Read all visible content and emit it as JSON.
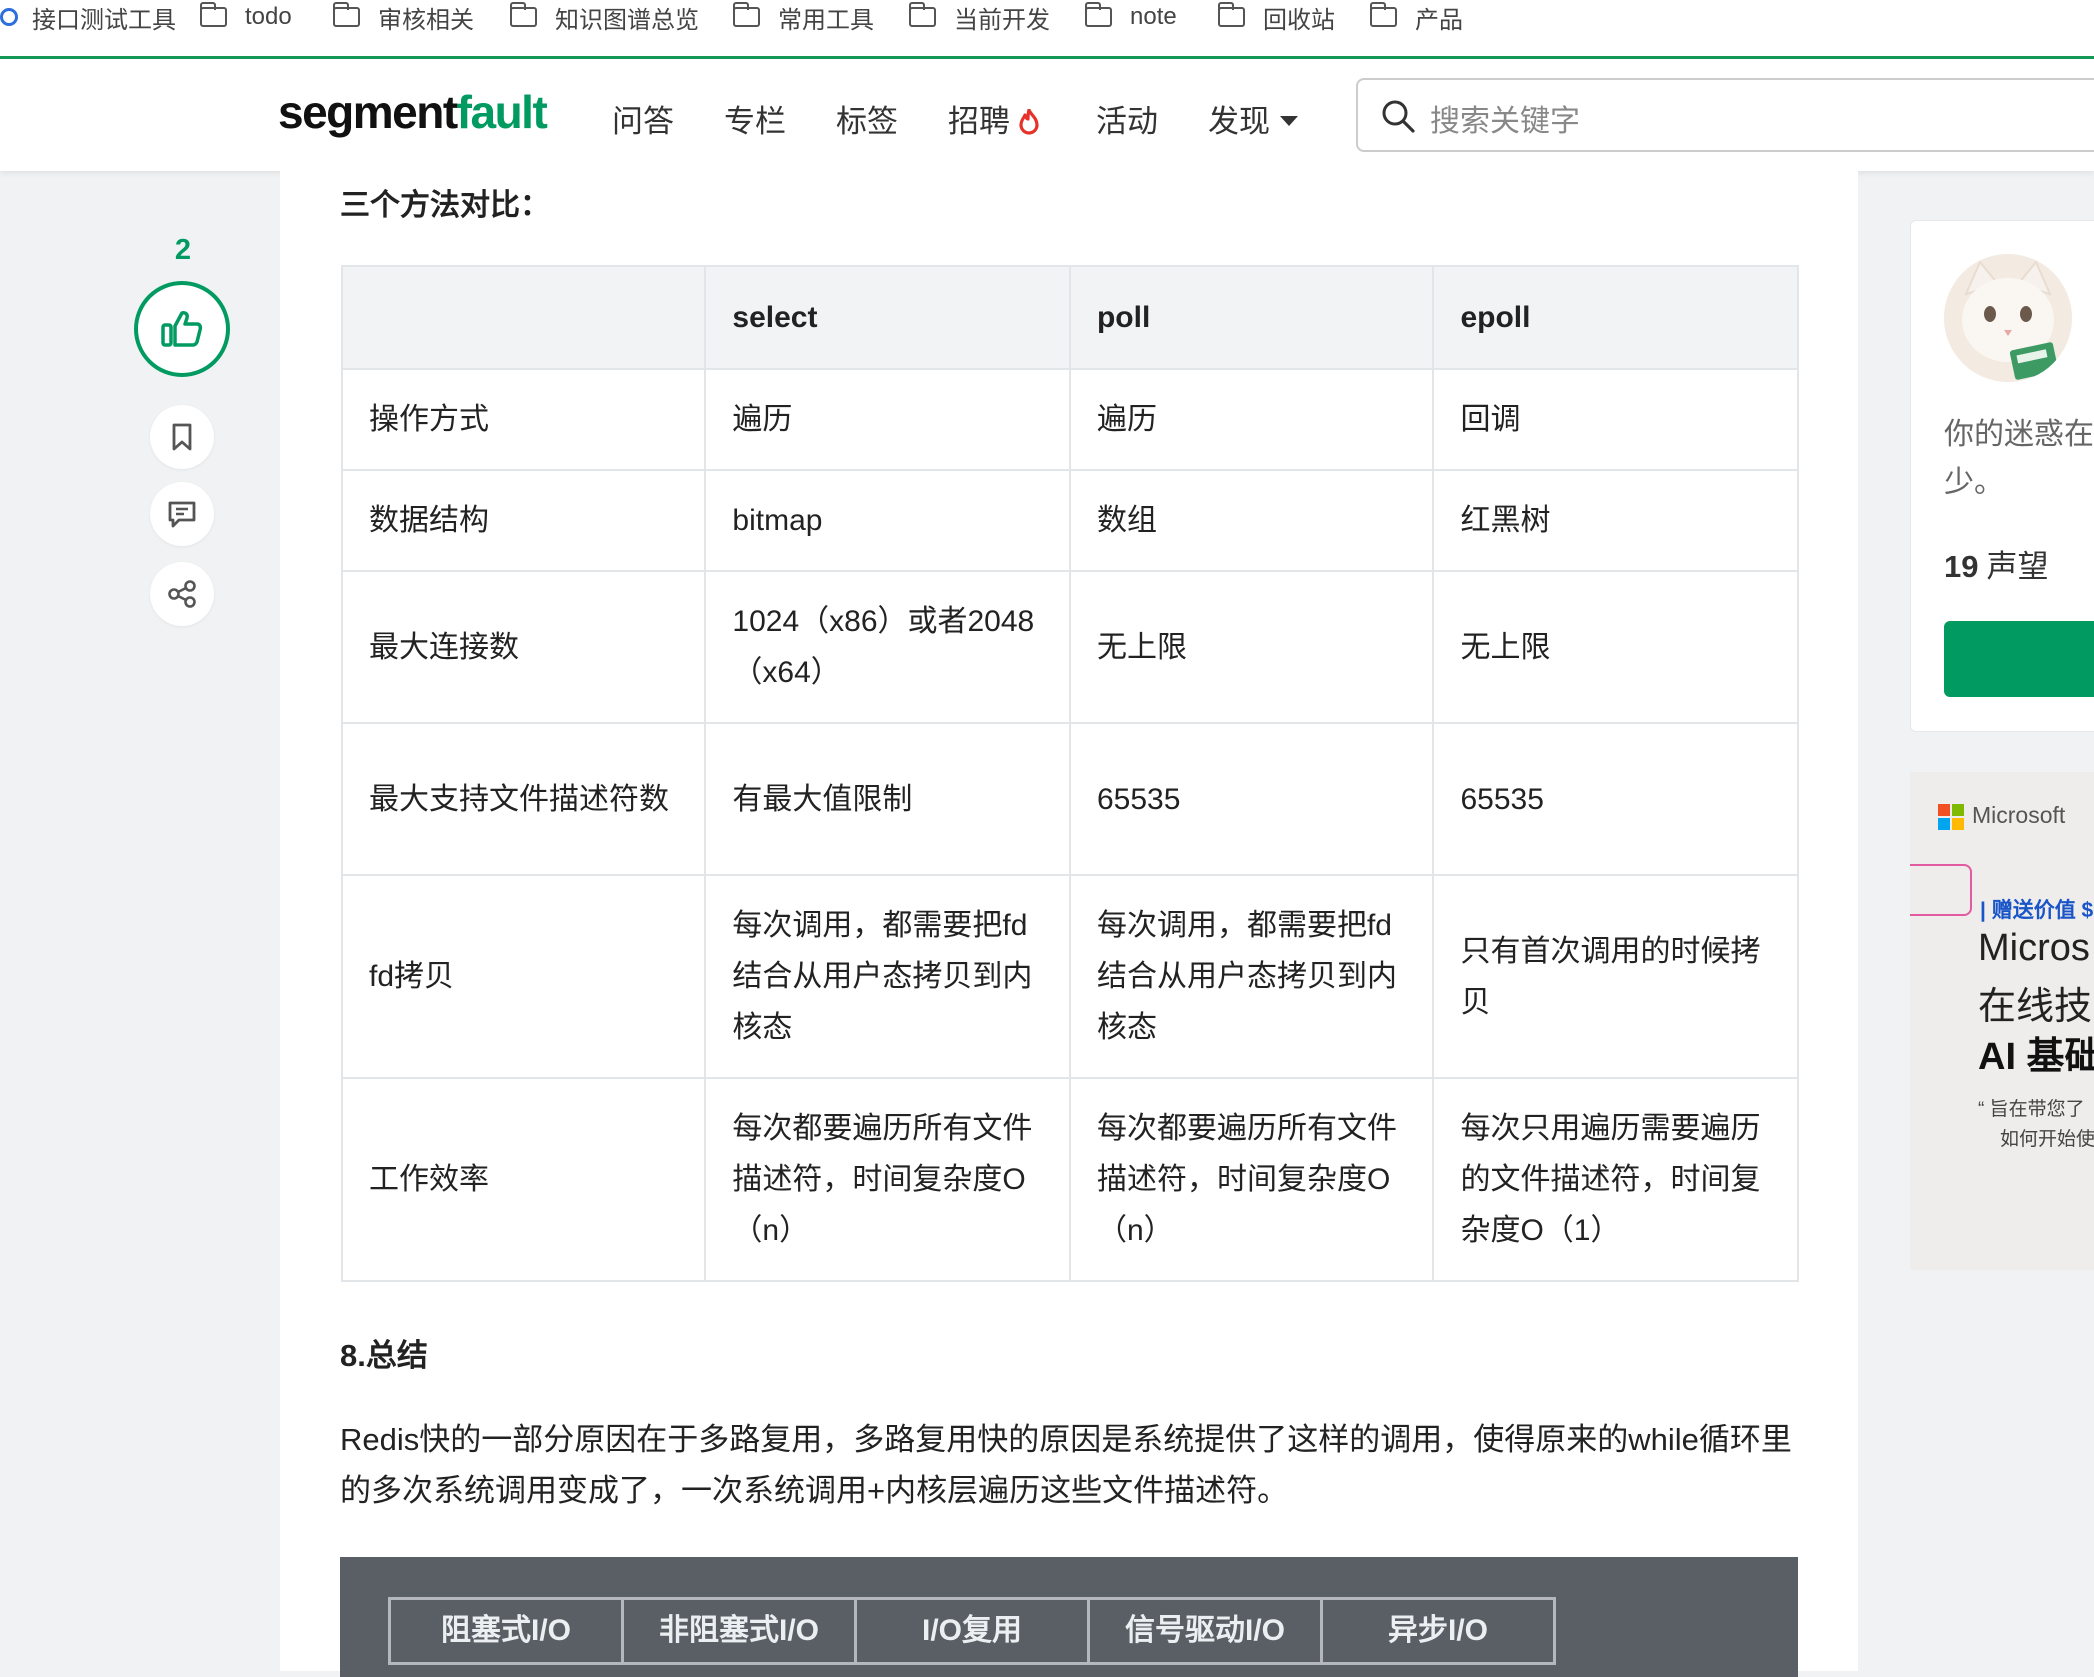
{
  "bookmarks": [
    "接口测试工具",
    "todo",
    "审核相关",
    "知识图谱总览",
    "常用工具",
    "当前开发",
    "note",
    "回收站",
    "产品"
  ],
  "header": {
    "logo_main": "segment",
    "logo_accent": "fault",
    "nav": [
      "问答",
      "专栏",
      "标签",
      "招聘",
      "活动",
      "发现"
    ],
    "search_placeholder": "搜索关键字"
  },
  "article": {
    "section_heading": "三个方法对比：",
    "table": {
      "headers": [
        "",
        "select",
        "poll",
        "epoll"
      ],
      "rows": [
        [
          "操作方式",
          "遍历",
          "遍历",
          "回调"
        ],
        [
          "数据结构",
          "bitmap",
          "数组",
          "红黑树"
        ],
        [
          "最大连接数",
          "1024（x86）或者2048（x64）",
          "无上限",
          "无上限"
        ],
        [
          "最大支持文件描述符数",
          "有最大值限制",
          "65535",
          "65535"
        ],
        [
          "fd拷贝",
          "每次调用，都需要把fd结合从用户态拷贝到内核态",
          "每次调用，都需要把fd结合从用户态拷贝到内核态",
          "只有首次调用的时候拷贝"
        ],
        [
          "工作效率",
          "每次都要遍历所有文件描述符，时间复杂度O（n）",
          "每次都要遍历所有文件描述符，时间复杂度O（n）",
          "每次只用遍历需要遍历的文件描述符，时间复杂度O（1）"
        ]
      ]
    },
    "summary_heading": "8.总结",
    "summary_text": "Redis快的一部分原因在于多路复用，多路复用快的原因是系统提供了这样的调用，使得原来的while循环里的多次系统调用变成了，一次系统调用+内核层遍历这些文件描述符。",
    "io_image_labels": [
      "阻塞式I/O",
      "非阻塞式I/O",
      "I/O复用",
      "信号驱动I/O",
      "异步I/O"
    ]
  },
  "actions": {
    "like_count": "2",
    "icons": [
      "thumbs-up-icon",
      "bookmark-icon",
      "comment-icon",
      "share-icon"
    ]
  },
  "sidebar": {
    "author_bio": "你的迷惑在少。",
    "reputation_value": "19",
    "reputation_label": "声望"
  },
  "ad": {
    "brand": "Microsoft",
    "tag": "| 赠送价值 $",
    "line1": "Micros",
    "line2": "在线技",
    "line3": "AI 基础",
    "quote1": "“ 旨在带您了",
    "quote2": "如何开始使"
  },
  "colors": {
    "brand_green": "#019a61",
    "bookmark_bar_border": "#159957",
    "hot_icon": "#e5322b"
  }
}
